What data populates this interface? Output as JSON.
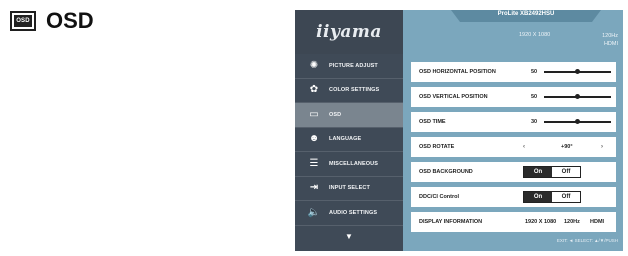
{
  "heading": {
    "icon_text": "OSD",
    "title": "OSD"
  },
  "osd_window": {
    "brand": "iiyama",
    "model": "ProLite XB2492HSU",
    "resolution": "1920 X 1080",
    "frequency": "120Hz",
    "input": "HDMI"
  },
  "menu": {
    "items": [
      {
        "label": "PICTURE ADJUST",
        "icon": "picture-adjust-icon",
        "glyph": "✺",
        "active": false
      },
      {
        "label": "COLOR SETTINGS",
        "icon": "color-settings-icon",
        "glyph": "✿",
        "active": false
      },
      {
        "label": "OSD",
        "icon": "osd-icon",
        "glyph": "▭",
        "active": true
      },
      {
        "label": "LANGUAGE",
        "icon": "language-icon",
        "glyph": "☻",
        "active": false
      },
      {
        "label": "MISCELLANEOUS",
        "icon": "miscellaneous-icon",
        "glyph": "☰",
        "active": false
      },
      {
        "label": "INPUT SELECT",
        "icon": "input-select-icon",
        "glyph": "⇥",
        "active": false
      },
      {
        "label": "AUDIO SETTINGS",
        "icon": "audio-settings-icon",
        "glyph": "🔈",
        "active": false
      }
    ],
    "more_glyph": "▼"
  },
  "settings": {
    "osd_horizontal_position": {
      "label": "OSD HORIZONTAL POSITION",
      "value": "50",
      "level": 0.5
    },
    "osd_vertical_position": {
      "label": "OSD VERTICAL POSITION",
      "value": "50",
      "level": 0.5
    },
    "osd_time": {
      "label": "OSD TIME",
      "value": "30",
      "level": 0.5
    },
    "osd_rotate": {
      "label": "OSD ROTATE",
      "value": "+90°",
      "left_arrow": "‹",
      "right_arrow": "›"
    },
    "osd_background": {
      "label": "OSD BACKGROUND",
      "on": "On",
      "off": "Off",
      "selected": "On"
    },
    "ddc_ci": {
      "label": "DDC/CI Control",
      "on": "On",
      "off": "Off",
      "selected": "On"
    },
    "display_information": {
      "label": "DISPLAY INFORMATION",
      "resolution": "1920 X 1080",
      "frequency": "120Hz",
      "input": "HDMI"
    }
  },
  "footer": "EXIT: ◄  SELECT: ▲/▼/PUSH"
}
